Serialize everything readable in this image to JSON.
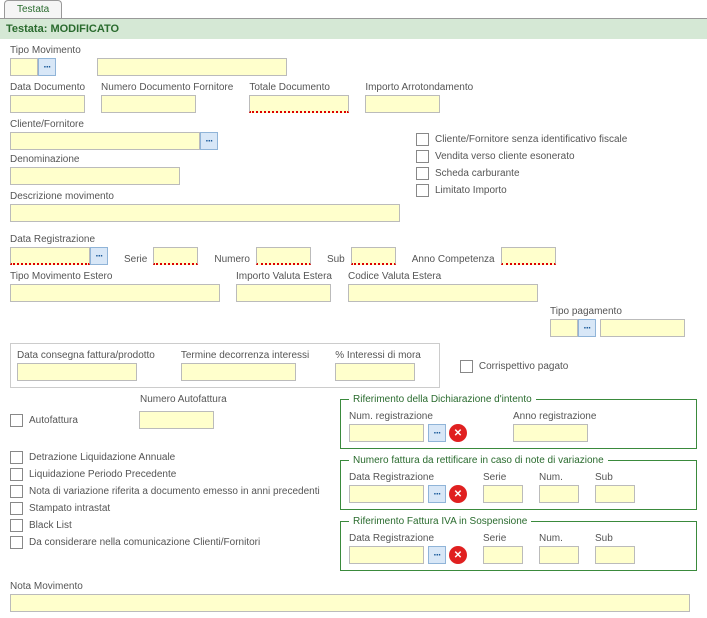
{
  "tab": {
    "label": "Testata"
  },
  "header": {
    "label": "Testata:",
    "status": "MODIFICATO"
  },
  "tipoMov": {
    "label": "Tipo Movimento"
  },
  "dataDoc": {
    "label": "Data Documento"
  },
  "numDocForn": {
    "label": "Numero Documento Fornitore"
  },
  "totDoc": {
    "label": "Totale Documento"
  },
  "impArr": {
    "label": "Importo Arrotondamento"
  },
  "cliForn": {
    "label": "Cliente/Fornitore"
  },
  "denom": {
    "label": "Denominazione"
  },
  "descMov": {
    "label": "Descrizione movimento"
  },
  "checks1": {
    "c1": "Cliente/Fornitore senza identificativo fiscale",
    "c2": "Vendita verso cliente esonerato",
    "c3": "Scheda carburante",
    "c4": "Limitato Importo"
  },
  "dataReg": {
    "label": "Data Registrazione"
  },
  "serie": {
    "label": "Serie"
  },
  "numero": {
    "label": "Numero"
  },
  "sub": {
    "label": "Sub"
  },
  "annoComp": {
    "label": "Anno Competenza"
  },
  "tipoMovEst": {
    "label": "Tipo Movimento Estero"
  },
  "impValEst": {
    "label": "Importo Valuta Estera"
  },
  "codValEst": {
    "label": "Codice Valuta Estera"
  },
  "tipoPag": {
    "label": "Tipo pagamento"
  },
  "dataConsFatt": {
    "label": "Data consegna fattura/prodotto"
  },
  "termDecInt": {
    "label": "Termine decorrenza interessi"
  },
  "percIntMora": {
    "label": "% Interessi di mora"
  },
  "corrPag": {
    "label": "Corrispettivo pagato"
  },
  "numAutofatt": {
    "label": "Numero Autofattura"
  },
  "autofatt": {
    "label": "Autofattura"
  },
  "checks2": {
    "c1": "Detrazione Liquidazione Annuale",
    "c2": "Liquidazione Periodo Precedente",
    "c3": "Nota di variazione riferita a documento emesso in anni precedenti",
    "c4": "Stampato intrastat",
    "c5": "Black List",
    "c6": "Da considerare nella comunicazione Clienti/Fornitori"
  },
  "grpRifDich": {
    "legend": "Riferimento della Dichiarazione d'intento",
    "numReg": "Num. registrazione",
    "annoReg": "Anno registrazione"
  },
  "grpNumFatt": {
    "legend": "Numero fattura da rettificare in caso di note di variazione",
    "dataReg": "Data Registrazione",
    "serie": "Serie",
    "num": "Num.",
    "sub": "Sub"
  },
  "grpRifIva": {
    "legend": "Riferimento Fattura IVA in Sospensione",
    "dataReg": "Data Registrazione",
    "serie": "Serie",
    "num": "Num.",
    "sub": "Sub"
  },
  "notaMov": {
    "label": "Nota Movimento"
  }
}
